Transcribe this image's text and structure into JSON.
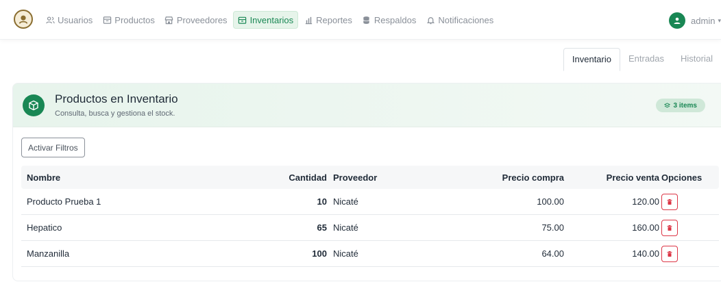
{
  "nav": {
    "items": [
      {
        "label": "Usuarios",
        "icon": "users-icon"
      },
      {
        "label": "Productos",
        "icon": "box-icon"
      },
      {
        "label": "Proveedores",
        "icon": "store-icon"
      },
      {
        "label": "Inventarios",
        "icon": "inventory-icon",
        "active": true
      },
      {
        "label": "Reportes",
        "icon": "bar-chart-icon"
      },
      {
        "label": "Respaldos",
        "icon": "database-icon"
      },
      {
        "label": "Notificaciones",
        "icon": "bell-icon"
      }
    ],
    "user": "admin"
  },
  "tabs": [
    {
      "label": "Inventario",
      "active": true
    },
    {
      "label": "Entradas"
    },
    {
      "label": "Historial"
    }
  ],
  "card": {
    "title": "Productos en Inventario",
    "subtitle": "Consulta, busca y gestiona el stock.",
    "badge": "3 items",
    "filter_button": "Activar Filtros"
  },
  "table": {
    "headers": {
      "nombre": "Nombre",
      "cantidad": "Cantidad",
      "proveedor": "Proveedor",
      "compra": "Precio compra",
      "venta": "Precio venta",
      "opciones": "Opciones"
    },
    "rows": [
      {
        "nombre": "Producto Prueba 1",
        "cantidad": "10",
        "proveedor": "Nicaté",
        "compra": "100.00",
        "venta": "120.00"
      },
      {
        "nombre": "Hepatico",
        "cantidad": "65",
        "proveedor": "Nicaté",
        "compra": "75.00",
        "venta": "160.00"
      },
      {
        "nombre": "Manzanilla",
        "cantidad": "100",
        "proveedor": "Nicaté",
        "compra": "64.00",
        "venta": "140.00"
      }
    ]
  },
  "colors": {
    "accent": "#198754",
    "danger": "#dc3545"
  }
}
